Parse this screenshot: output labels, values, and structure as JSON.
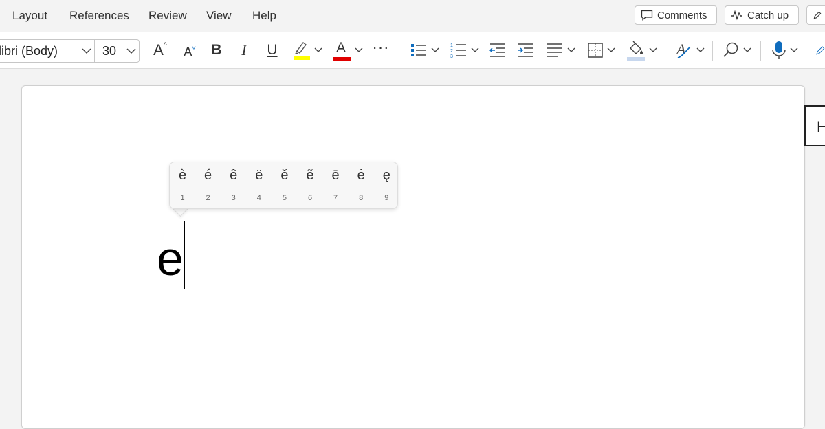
{
  "menu": {
    "items": [
      "Layout",
      "References",
      "Review",
      "View",
      "Help"
    ],
    "comments_label": "Comments",
    "catch_up_label": "Catch up"
  },
  "toolbar": {
    "font_name": "libri (Body)",
    "font_size": "30",
    "grow_font": "A",
    "shrink_font": "A",
    "bold": "B",
    "italic": "I",
    "underline": "U",
    "font_color_letter": "A",
    "more": "···",
    "colors": {
      "highlight": "#ffff00",
      "font_color": "#e00000",
      "accent_blue": "#0f6cbd"
    }
  },
  "accent_popup": {
    "options": [
      {
        "char": "è",
        "key": "1"
      },
      {
        "char": "é",
        "key": "2"
      },
      {
        "char": "ê",
        "key": "3"
      },
      {
        "char": "ë",
        "key": "4"
      },
      {
        "char": "ě",
        "key": "5"
      },
      {
        "char": "ẽ",
        "key": "6"
      },
      {
        "char": "ē",
        "key": "7"
      },
      {
        "char": "ė",
        "key": "8"
      },
      {
        "char": "ę",
        "key": "9"
      }
    ]
  },
  "document": {
    "text": "e",
    "side_tab_text": "H"
  }
}
